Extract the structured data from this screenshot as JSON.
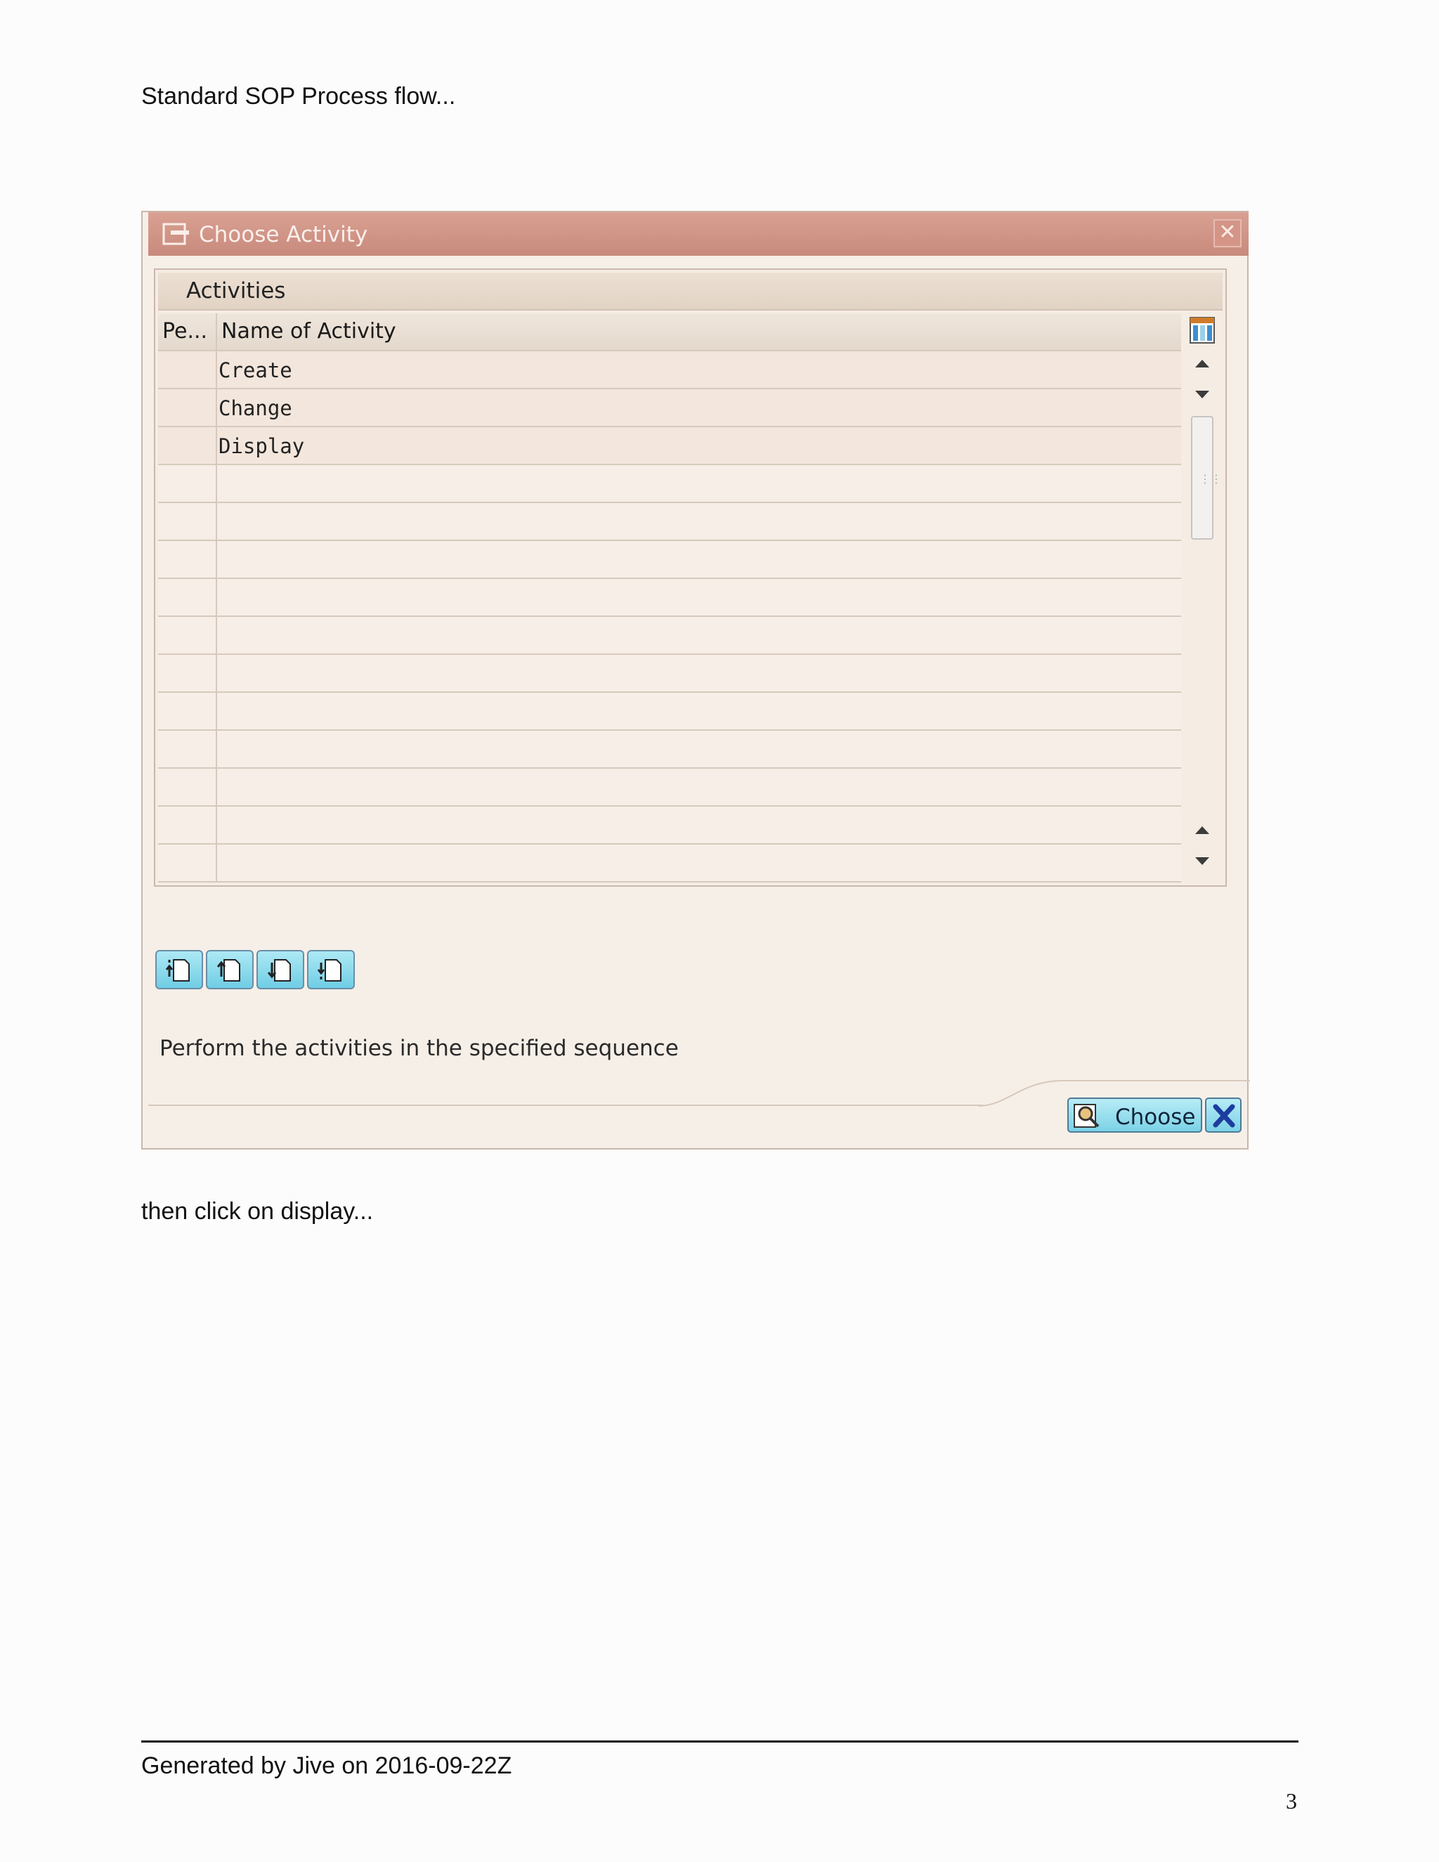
{
  "document": {
    "intro": "Standard SOP Process flow...",
    "after": "then click on display...",
    "footer": "Generated by Jive on 2016-09-22Z",
    "page_number": "3"
  },
  "dialog": {
    "title": "Choose Activity",
    "panel_title": "Activities",
    "columns": [
      "Pe...",
      "Name of Activity"
    ],
    "activities": [
      "Create",
      "Change",
      "Display"
    ],
    "hint": "Perform the activities in the specified sequence",
    "choose_label": "Choose",
    "icons": {
      "title": "dialog-icon",
      "close": "close-icon",
      "layout": "table-layout-icon",
      "choose": "magnifier-icon",
      "cancel": "cancel-icon"
    }
  }
}
